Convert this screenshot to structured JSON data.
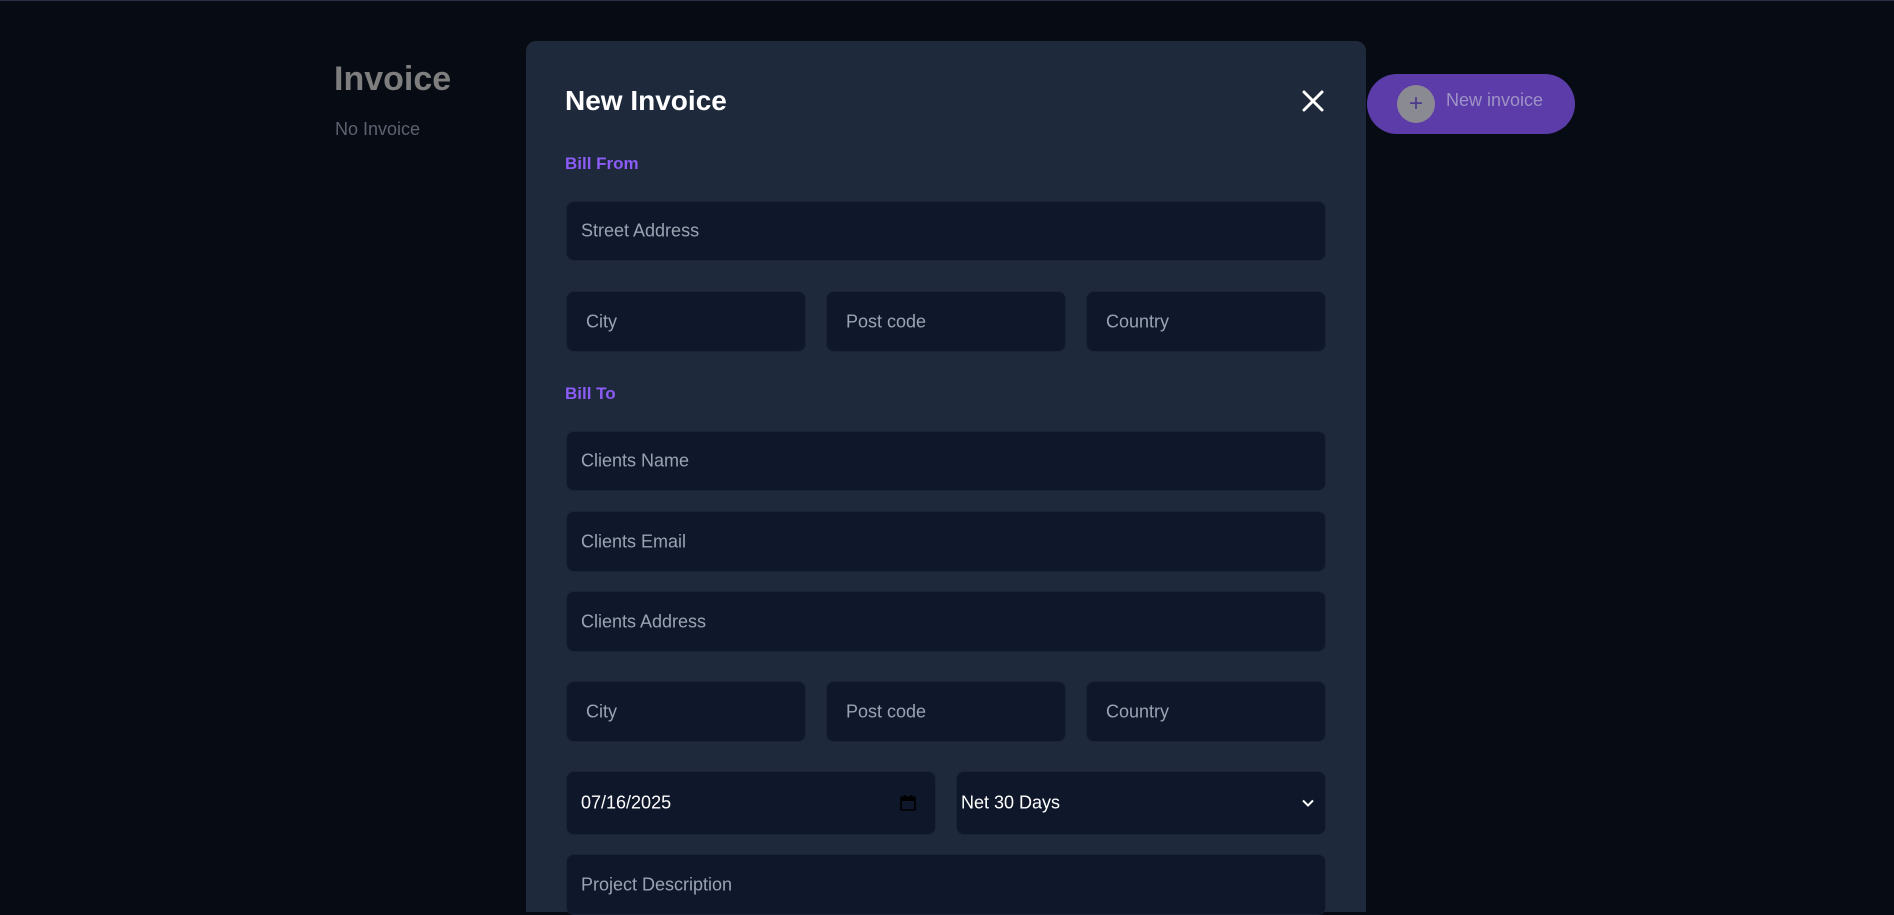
{
  "page": {
    "title": "Invoice",
    "subtitle": "No Invoice"
  },
  "new_invoice_button": {
    "icon": "plus-icon",
    "label": "New invoice",
    "plus": "+"
  },
  "modal": {
    "title": "New Invoice",
    "close_icon": "close-icon",
    "bill_from": {
      "heading": "Bill From",
      "street": {
        "placeholder": "Street Address"
      },
      "city": {
        "placeholder": "City"
      },
      "post_code": {
        "placeholder": "Post code"
      },
      "country": {
        "placeholder": "Country"
      }
    },
    "bill_to": {
      "heading": "Bill To",
      "client_name": {
        "placeholder": "Clients Name"
      },
      "client_email": {
        "placeholder": "Clients Email"
      },
      "client_address": {
        "placeholder": "Clients Address"
      },
      "city": {
        "placeholder": "City"
      },
      "post_code": {
        "placeholder": "Post code"
      },
      "country": {
        "placeholder": "Country"
      }
    },
    "invoice_date": {
      "value": "07/16/2025",
      "icon": "calendar-icon"
    },
    "payment_terms": {
      "value": "Net 30 Days",
      "icon": "chevron-down-icon"
    },
    "project_description": {
      "placeholder": "Project Description"
    }
  },
  "colors": {
    "background": "#070b14",
    "modal": "#1e293b",
    "input": "#0f172a",
    "accent": "#8b5cf6",
    "button": "#5b3ca8"
  }
}
